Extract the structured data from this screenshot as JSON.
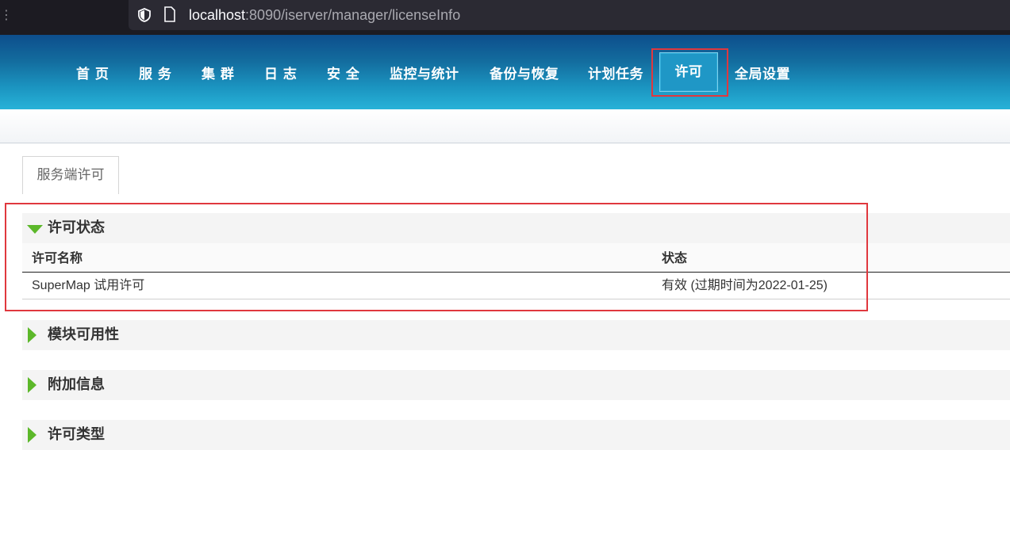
{
  "browser": {
    "url_host": "localhost",
    "url_rest": ":8090/iserver/manager/licenseInfo"
  },
  "nav": {
    "items": [
      {
        "label": "首 页"
      },
      {
        "label": "服 务"
      },
      {
        "label": "集 群"
      },
      {
        "label": "日 志"
      },
      {
        "label": "安 全"
      },
      {
        "label": "监控与统计"
      },
      {
        "label": "备份与恢复"
      },
      {
        "label": "计划任务"
      },
      {
        "label": "许可",
        "active": true
      },
      {
        "label": "全局设置"
      }
    ]
  },
  "tab": {
    "label": "服务端许可"
  },
  "sections": [
    {
      "title": "许可状态",
      "expanded": true
    },
    {
      "title": "模块可用性",
      "expanded": false
    },
    {
      "title": "附加信息",
      "expanded": false
    },
    {
      "title": "许可类型",
      "expanded": false
    }
  ],
  "license_table": {
    "columns": [
      "许可名称",
      "状态"
    ],
    "rows": [
      {
        "name": "SuperMap 试用许可",
        "status": "有效 (过期时间为2022-01-25)"
      }
    ]
  },
  "colors": {
    "accent_green": "#5cb82a",
    "highlight_red": "#e0383e",
    "nav_top": "#0d4e8c",
    "nav_bottom": "#27b2d8"
  }
}
